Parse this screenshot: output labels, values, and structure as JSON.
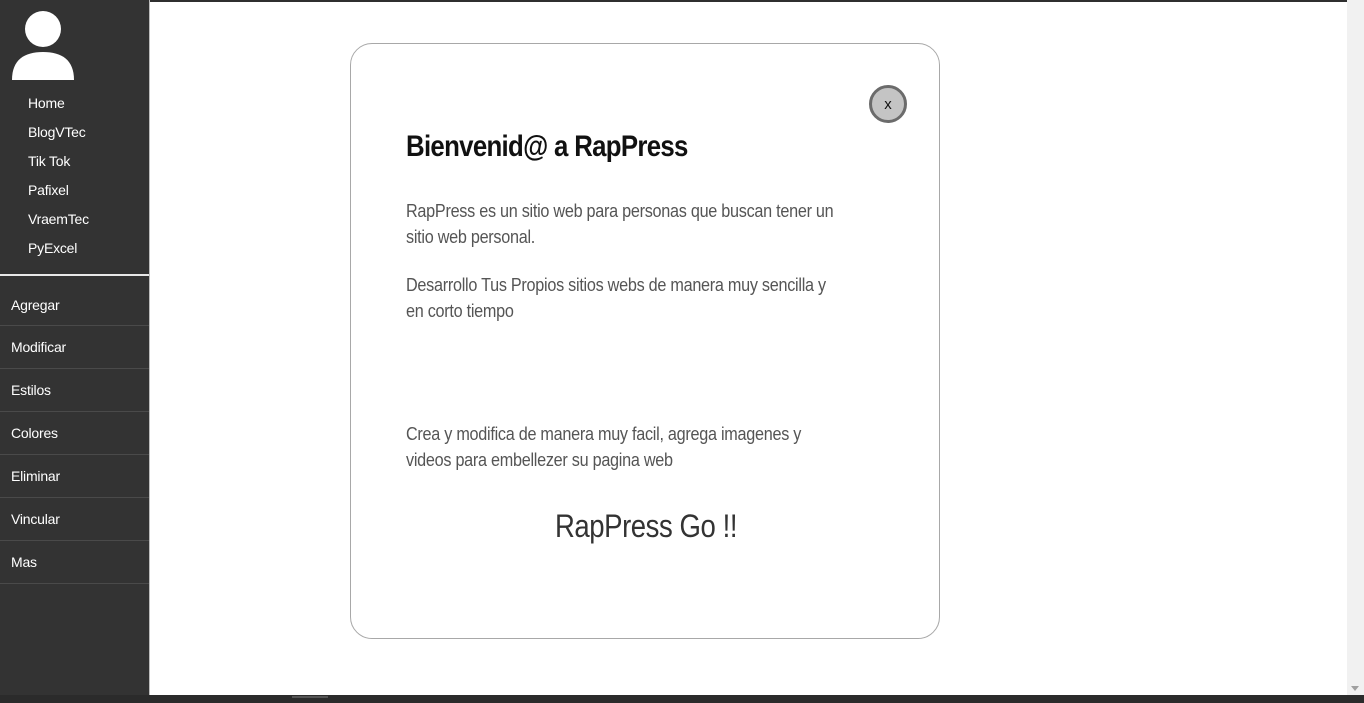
{
  "sidebar": {
    "avatar_icon": "user-icon",
    "top_links": [
      {
        "label": "Home"
      },
      {
        "label": "BlogVTec"
      },
      {
        "label": "Tik Tok"
      },
      {
        "label": "Pafixel"
      },
      {
        "label": "VraemTec"
      },
      {
        "label": "PyExcel"
      }
    ],
    "menu": [
      {
        "label": "Agregar"
      },
      {
        "label": "Modificar"
      },
      {
        "label": "Estilos"
      },
      {
        "label": "Colores"
      },
      {
        "label": "Eliminar"
      },
      {
        "label": "Vincular"
      },
      {
        "label": "Mas"
      }
    ]
  },
  "modal": {
    "close_label": "x",
    "title": "Bienvenid@ a RapPress",
    "paragraph_1": "RapPress es un sitio web para personas que buscan tener un sitio web personal.",
    "paragraph_2": "Desarrollo Tus Propios sitios webs de manera muy sencilla y en corto tiempo",
    "paragraph_3": "Crea y modifica de manera muy facil, agrega imagenes y videos para embellezer su pagina web",
    "tagline": "RapPress Go !!"
  },
  "colors": {
    "sidebar_bg": "#333333",
    "sidebar_text": "#ffffff",
    "close_button_bg": "#c4c4c4",
    "modal_border": "#a8a8a8"
  }
}
